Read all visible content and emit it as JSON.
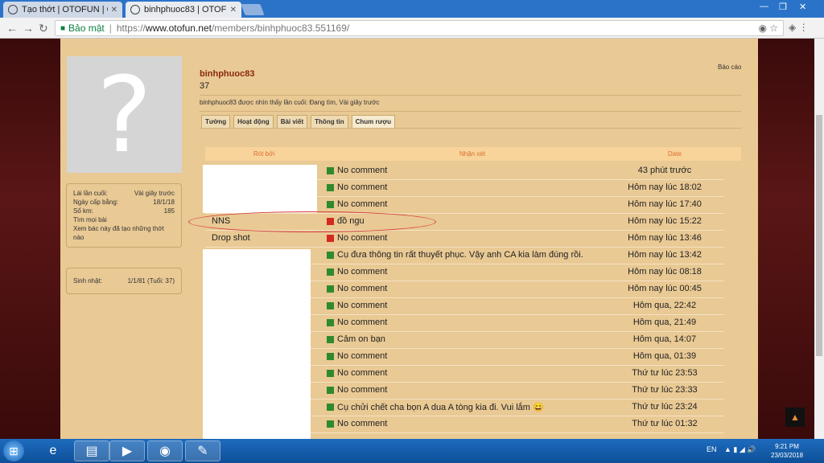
{
  "browser": {
    "tabs": [
      {
        "title": "Tạo thớt | OTOFUN | Cộn",
        "active": false
      },
      {
        "title": "binhphuoc83 | OTOFUN",
        "active": true
      }
    ],
    "secure_label": "Bảo mật",
    "url_scheme": "https://",
    "url_host": "www.otofun.net",
    "url_path": "/members/binhphuoc83.551169/"
  },
  "profile": {
    "username": "binhphuoc83",
    "value": "37",
    "report_label": "Báo cáo",
    "last_seen": "binhphuoc83 được nhìn thấy lần cuối: Đang tìm, Vài giây trước",
    "tabs": [
      "Tường",
      "Hoạt động",
      "Bài viết",
      "Thông tin",
      "Chum rượu"
    ],
    "active_tab": "Chum rượu"
  },
  "sidebar": {
    "stats": [
      {
        "label": "Lái lần cuối:",
        "value": "Vài giây trước"
      },
      {
        "label": "Ngày cấp bằng:",
        "value": "18/1/18"
      },
      {
        "label": "Số km:",
        "value": "185"
      },
      {
        "label": "Tìm mọi bài",
        "value": ""
      },
      {
        "label": "Xem bác này đã tạo những thớt nào",
        "value": ""
      }
    ],
    "birthday_label": "Sinh nhật:",
    "birthday_value": "1/1/81 (Tuổi: 37)"
  },
  "table": {
    "headers": [
      "Rót bởi",
      "Nhận xét",
      "Date"
    ],
    "rows": [
      {
        "giver": "",
        "status": "good",
        "comment": "No comment",
        "date": "43 phút trước"
      },
      {
        "giver": "",
        "status": "good",
        "comment": "No comment",
        "date": "Hôm nay lúc 18:02"
      },
      {
        "giver": "",
        "status": "good",
        "comment": "No comment",
        "date": "Hôm nay lúc 17:40"
      },
      {
        "giver": "NNS",
        "status": "bad",
        "comment": "đồ ngu",
        "date": "Hôm nay lúc 15:22"
      },
      {
        "giver": "Drop shot",
        "status": "bad",
        "comment": "No comment",
        "date": "Hôm nay lúc 13:46"
      },
      {
        "giver": "",
        "status": "good",
        "comment": "Cụ đưa thông tin rất thuyết phục. Vậy anh CA kia làm đúng rồi.",
        "date": "Hôm nay lúc 13:42"
      },
      {
        "giver": "",
        "status": "good",
        "comment": "No comment",
        "date": "Hôm nay lúc 08:18"
      },
      {
        "giver": "",
        "status": "good",
        "comment": "No comment",
        "date": "Hôm nay lúc 00:45"
      },
      {
        "giver": "",
        "status": "good",
        "comment": "No comment",
        "date": "Hôm qua, 22:42"
      },
      {
        "giver": "",
        "status": "good",
        "comment": "No comment",
        "date": "Hôm qua, 21:49"
      },
      {
        "giver": "",
        "status": "good",
        "comment": "Cảm on bạn",
        "date": "Hôm qua, 14:07"
      },
      {
        "giver": "",
        "status": "good",
        "comment": "No comment",
        "date": "Hôm qua, 01:39"
      },
      {
        "giver": "",
        "status": "good",
        "comment": "No comment",
        "date": "Thứ tư lúc 23:53"
      },
      {
        "giver": "",
        "status": "good",
        "comment": "No comment",
        "date": "Thứ tư lúc 23:33"
      },
      {
        "giver": "",
        "status": "good",
        "comment": "Cụ chửi chết cha bọn A dua A tòng kia đi. Vui lắm 😄",
        "date": "Thứ tư lúc 23:24"
      },
      {
        "giver": "",
        "status": "good",
        "comment": "No comment",
        "date": "Thứ tư lúc 01:32"
      }
    ]
  },
  "taskbar": {
    "lang": "EN",
    "time": "9:21 PM",
    "date": "23/03/2018"
  },
  "colors": {
    "page_bg": "#e9c994",
    "header_bg": "#f8d39a",
    "header_text": "#d96f2c",
    "username": "#8a2b0d",
    "good_flag": "#2f8a2f",
    "bad_flag": "#d22a1f"
  },
  "icons": {
    "tab_favicon": "steering-wheel-icon",
    "lock": "lock-icon",
    "scroll_top": "arrow-up-icon"
  }
}
